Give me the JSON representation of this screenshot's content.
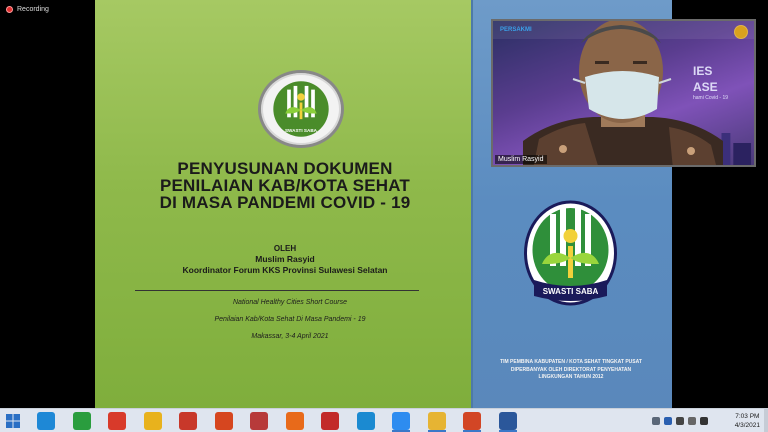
{
  "recording": {
    "label": "Recording"
  },
  "slide": {
    "logo_text": "SWASTI SABA",
    "title_lines": [
      "PENYUSUNAN DOKUMEN",
      "PENILAIAN KAB/KOTA SEHAT",
      "DI MASA PANDEMI COVID - 19"
    ],
    "by_label": "OLEH",
    "presenter_name": "Muslim Rasyid",
    "presenter_role": "Koordinator Forum KKS Provinsi Sulawesi Selatan",
    "course_lines": [
      "National Healthy Cities Short  Course",
      "Penilaian Kab/Kota Sehat  Di Masa Pandemi  - 19",
      "Makassar,  3-4 April 2021"
    ],
    "big_logo_text": "SWASTI SABA",
    "footer_lines": [
      "TIM PEMBINA KABUPATEN / KOTA SEHAT TINGKAT PUSAT",
      "DIPERBANYAK OLEH DIREKTORAT PENYEHATAN",
      "LINGKUNGAN TAHUN 2012"
    ]
  },
  "video": {
    "participant_name": "Muslim Rasyid",
    "banner_logo": "PERSAKMI",
    "bg_text_lines": [
      "IES",
      "ASE"
    ],
    "bg_subtext": "hami Covid - 19"
  },
  "taskbar": {
    "time": "7:03 PM",
    "date": "4/3/2021",
    "apps": [
      {
        "name": "internet-explorer-icon",
        "color": "#1e88d6"
      },
      {
        "name": "store-icon",
        "color": "#2a9d3e"
      },
      {
        "name": "app-red-circle-icon",
        "color": "#d83a2a"
      },
      {
        "name": "chrome-icon",
        "color": "#e8b21d"
      },
      {
        "name": "app-red-box-icon",
        "color": "#c8382a"
      },
      {
        "name": "app-triangle-icon",
        "color": "#d6461f"
      },
      {
        "name": "app-red-square-icon",
        "color": "#b73a3a"
      },
      {
        "name": "firefox-icon",
        "color": "#e86a1a"
      },
      {
        "name": "app-mosaic-icon",
        "color": "#c22a2a"
      },
      {
        "name": "edge-icon",
        "color": "#1b8ad1"
      },
      {
        "name": "zoom-icon",
        "color": "#2d8cf0"
      },
      {
        "name": "file-explorer-icon",
        "color": "#e6b433"
      },
      {
        "name": "powerpoint-icon",
        "color": "#d24625"
      },
      {
        "name": "word-icon",
        "color": "#2b579a"
      }
    ]
  }
}
